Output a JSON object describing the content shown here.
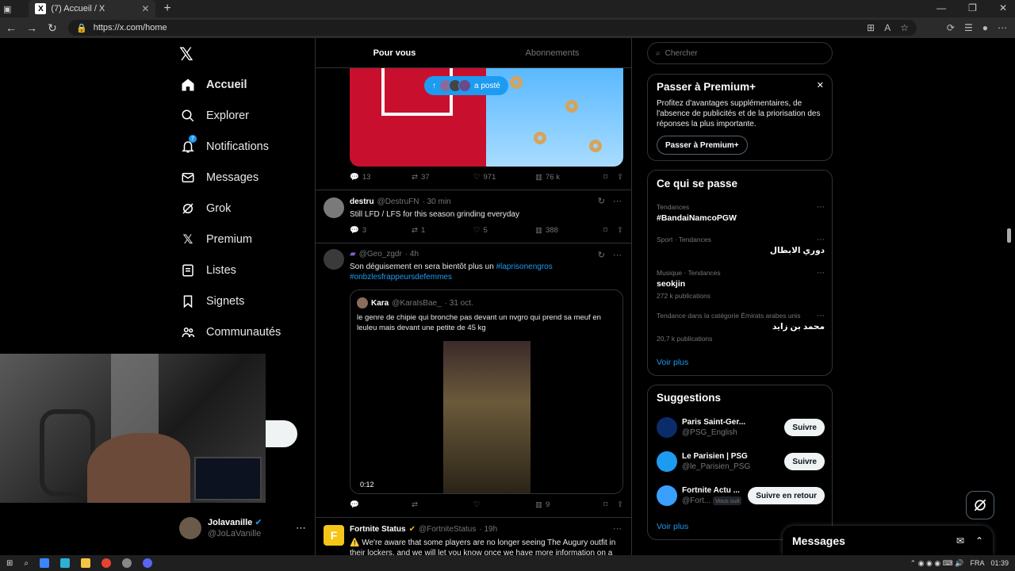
{
  "browser": {
    "tab_title": "(7) Accueil / X",
    "url": "https://x.com/home",
    "window_controls": [
      "—",
      "❐",
      "✕"
    ]
  },
  "nav": {
    "logo": "𝕏",
    "items": [
      {
        "label": "Accueil",
        "icon": "home-icon"
      },
      {
        "label": "Explorer",
        "icon": "search-icon"
      },
      {
        "label": "Notifications",
        "icon": "bell-icon",
        "badge": "7"
      },
      {
        "label": "Messages",
        "icon": "mail-icon"
      },
      {
        "label": "Grok",
        "icon": "grok-icon"
      },
      {
        "label": "Premium",
        "icon": "x-premium-icon"
      },
      {
        "label": "Listes",
        "icon": "list-icon"
      },
      {
        "label": "Signets",
        "icon": "bookmark-icon"
      },
      {
        "label": "Communautés",
        "icon": "people-icon"
      }
    ],
    "profile": {
      "name": "Jolavanille",
      "handle": "@JoLaVanille"
    }
  },
  "timeline": {
    "tabs": [
      "Pour vous",
      "Abonnements"
    ],
    "posted_pill": "a posté",
    "tweet1_actions": {
      "replies": "13",
      "reposts": "37",
      "likes": "971",
      "views": "76 k"
    },
    "tweet2": {
      "name": "destru",
      "handle": "@DestruFN",
      "time": "· 30 min",
      "text": "Still LFD / LFS for this season grinding everyday",
      "replies": "3",
      "reposts": "1",
      "likes": "5",
      "views": "388"
    },
    "tweet3": {
      "handle": "@Geo_zgdr",
      "time": "· 4h",
      "text": "Son déguisement en sera bientôt plus un ",
      "hashtag1": "#laprisonengros",
      "hashtag2": "#onbzlesfrappeursdefemmes",
      "quote": {
        "name": "Kara",
        "handle": "@KaraIsBae_",
        "time": "· 31 oct.",
        "text": "le genre de chipie qui bronche pas devant un nvgro qui prend sa meuf en leuleu mais devant une petite de 45 kg",
        "video_time": "0:12"
      },
      "views": "9"
    },
    "tweet4": {
      "name": "Fortnite Status",
      "handle": "@FortniteStatus",
      "time": "· 19h",
      "text": "⚠️ We're aware that some players are no longer seeing The Augury outfit in their lockers, and we will let you know once we have more information on a"
    }
  },
  "right": {
    "search_placeholder": "Chercher",
    "premium": {
      "title": "Passer à Premium+",
      "desc": "Profitez d'avantages supplémentaires, de l'absence de publicités et de la priorisation des réponses la plus importante.",
      "button": "Passer à Premium+"
    },
    "trends": {
      "title": "Ce qui se passe",
      "items": [
        {
          "ctx": "Tendances",
          "name": "#BandaiNamcoPGW",
          "count": ""
        },
        {
          "ctx": "Sport · Tendances",
          "name": "دوري الابطال",
          "count": ""
        },
        {
          "ctx": "Musique · Tendances",
          "name": "seokjin",
          "count": "272 k publications"
        },
        {
          "ctx": "Tendance dans la catégorie Émirats arabes unis",
          "name": "محمد بن زايد",
          "count": "20,7 k publications"
        }
      ],
      "see_more": "Voir plus"
    },
    "suggestions": {
      "title": "Suggestions",
      "items": [
        {
          "name": "Paris Saint-Ger...",
          "handle": "@PSG_English",
          "button": "Suivre",
          "color": "#0a2c6b"
        },
        {
          "name": "Le Parisien | PSG",
          "handle": "@le_Parisien_PSG",
          "button": "Suivre",
          "color": "#1d9bf0"
        },
        {
          "name": "Fortnite Actu ...",
          "handle": "@Fort...",
          "badge": "Vous suit",
          "button": "Suivre en retour",
          "color": "#3aa0ff"
        }
      ],
      "see_more": "Voir plus"
    },
    "messages": "Messages"
  },
  "taskbar": {
    "lang": "FRA",
    "time": "01:39"
  }
}
